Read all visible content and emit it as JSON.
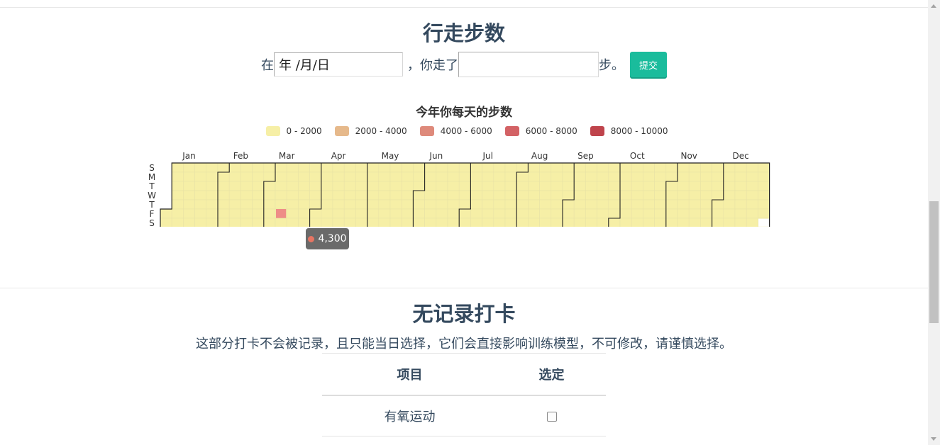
{
  "steps_section": {
    "title": "行走步数",
    "form": {
      "prefix": "在",
      "date_placeholder": "年 /月/日",
      "middle": "，你走了",
      "steps_value": "",
      "suffix": "步。",
      "submit_label": "提交"
    }
  },
  "chart_data": {
    "type": "heatmap",
    "title": "今年你每天的步数",
    "legend": [
      {
        "label": "0 - 2000",
        "range": [
          0,
          2000
        ],
        "color": "#f6efa6"
      },
      {
        "label": "2000 - 4000",
        "range": [
          2000,
          4000
        ],
        "color": "#e6b98b"
      },
      {
        "label": "4000 - 6000",
        "range": [
          4000,
          6000
        ],
        "color": "#de8a7b"
      },
      {
        "label": "6000 - 8000",
        "range": [
          6000,
          8000
        ],
        "color": "#d36265"
      },
      {
        "label": "8000 - 10000",
        "range": [
          8000,
          10000
        ],
        "color": "#bf444c"
      }
    ],
    "months": [
      "Jan",
      "Feb",
      "Mar",
      "Apr",
      "May",
      "Jun",
      "Jul",
      "Aug",
      "Sep",
      "Oct",
      "Nov",
      "Dec"
    ],
    "weekdays": [
      "S",
      "M",
      "T",
      "W",
      "T",
      "F",
      "S"
    ],
    "points": [
      {
        "date": "2016-03-11",
        "value": 4300
      }
    ],
    "tooltip": {
      "value_text": "4,300"
    }
  },
  "nolog_section": {
    "title": "无记录打卡",
    "description": "这部分打卡不会被记录，且只能当日选择，它们会直接影响训练模型，不可修改，请谨慎选择。",
    "table": {
      "headers": [
        "项目",
        "选定"
      ],
      "rows": [
        {
          "item": "有氧运动",
          "checked": false
        }
      ]
    }
  }
}
